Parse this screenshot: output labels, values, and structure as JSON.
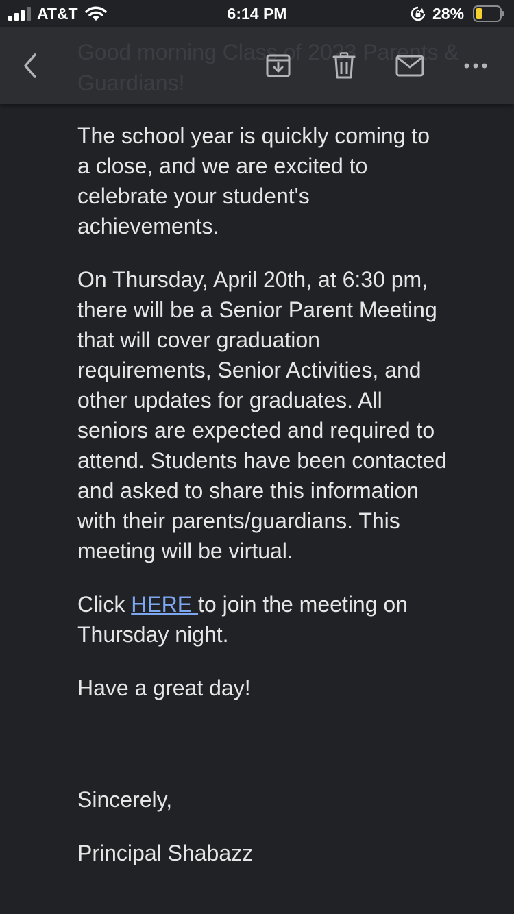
{
  "status_bar": {
    "carrier": "AT&T",
    "time": "6:14 PM",
    "battery_percent": "28%",
    "battery_level": 0.28,
    "battery_color": "#f5d130"
  },
  "toolbar": {
    "ghost_subject": "Good morning Class of 2023 Parents & Guardians!",
    "icons": [
      "back-chevron-icon",
      "archive-icon",
      "trash-icon",
      "mail-icon",
      "more-icon"
    ]
  },
  "email": {
    "paragraph_1": "The school year is quickly coming to a close, and we are excited to celebrate your student's achievements.",
    "paragraph_2": "On Thursday, April 20th, at 6:30 pm, there will be a Senior Parent Meeting that will cover graduation requirements, Senior Activities, and other updates for graduates. All seniors are expected and required to attend. Students have been contacted and asked to share this information with their parents/guardians. This meeting will be virtual.",
    "click_prefix": "Click ",
    "link_text": "HERE ",
    "click_suffix": "to join the meeting on Thursday night.",
    "greeting": "Have a great day!",
    "closing": "Sincerely,",
    "signature": "Principal Shabazz"
  },
  "colors": {
    "background": "#212226",
    "toolbar": "#2d2e32",
    "text": "#e6e6e7",
    "link": "#7ea7f2"
  }
}
